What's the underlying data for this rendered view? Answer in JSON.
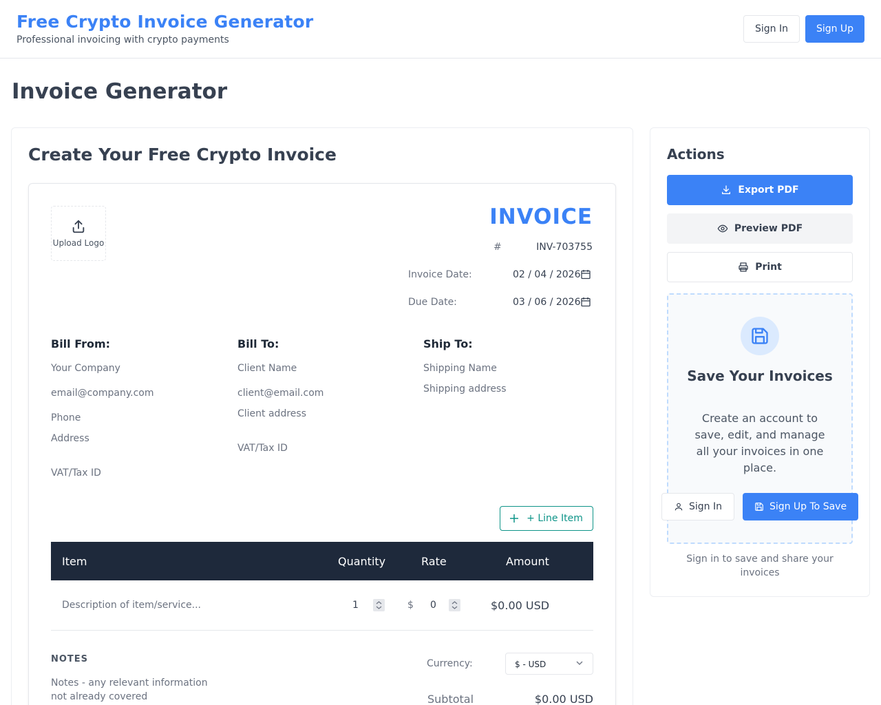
{
  "header": {
    "title": "Free Crypto Invoice Generator",
    "subtitle": "Professional invoicing with crypto payments",
    "sign_in": "Sign In",
    "sign_up": "Sign Up"
  },
  "page": {
    "title": "Invoice Generator"
  },
  "card": {
    "heading": "Create Your Free Crypto Invoice"
  },
  "invoice": {
    "upload_logo": "Upload Logo",
    "title": "INVOICE",
    "hash": "#",
    "number": "INV-703755",
    "invoice_date_label": "Invoice Date:",
    "invoice_date": "02 / 04 / 2026",
    "due_date_label": "Due Date:",
    "due_date": "03 / 06 / 2026"
  },
  "bill_from": {
    "heading": "Bill From:",
    "company": "Your Company",
    "email": "email@company.com",
    "phone": "Phone",
    "address": "Address",
    "tax": "VAT/Tax ID"
  },
  "bill_to": {
    "heading": "Bill To:",
    "name": "Client Name",
    "email": "client@email.com",
    "address": "Client address",
    "tax": "VAT/Tax ID"
  },
  "ship_to": {
    "heading": "Ship To:",
    "name": "Shipping Name",
    "address": "Shipping address"
  },
  "line_items": {
    "add_button": "+ Line Item",
    "columns": [
      "Item",
      "Quantity",
      "Rate",
      "Amount"
    ],
    "rows": [
      {
        "description": "Description of item/service...",
        "quantity": "1",
        "currency_symbol": "$",
        "rate": "0",
        "amount": "$0.00 USD"
      }
    ]
  },
  "notes": {
    "heading": "NOTES",
    "text": "Notes - any relevant information not already covered"
  },
  "totals": {
    "currency_label": "Currency:",
    "currency_value": "$ - USD",
    "subtotal_label": "Subtotal",
    "subtotal_value": "$0.00 USD"
  },
  "actions": {
    "heading": "Actions",
    "export_pdf": "Export PDF",
    "preview_pdf": "Preview PDF",
    "print": "Print",
    "save_title": "Save Your Invoices",
    "save_desc": "Create an account to save, edit, and manage all your invoices in one place.",
    "sign_in": "Sign In",
    "sign_up_save": "Sign Up To Save",
    "footer": "Sign in to save and share your invoices"
  },
  "colors": {
    "accent": "#3b82f6",
    "teal": "#0d9488",
    "table_header": "#1e293b"
  }
}
